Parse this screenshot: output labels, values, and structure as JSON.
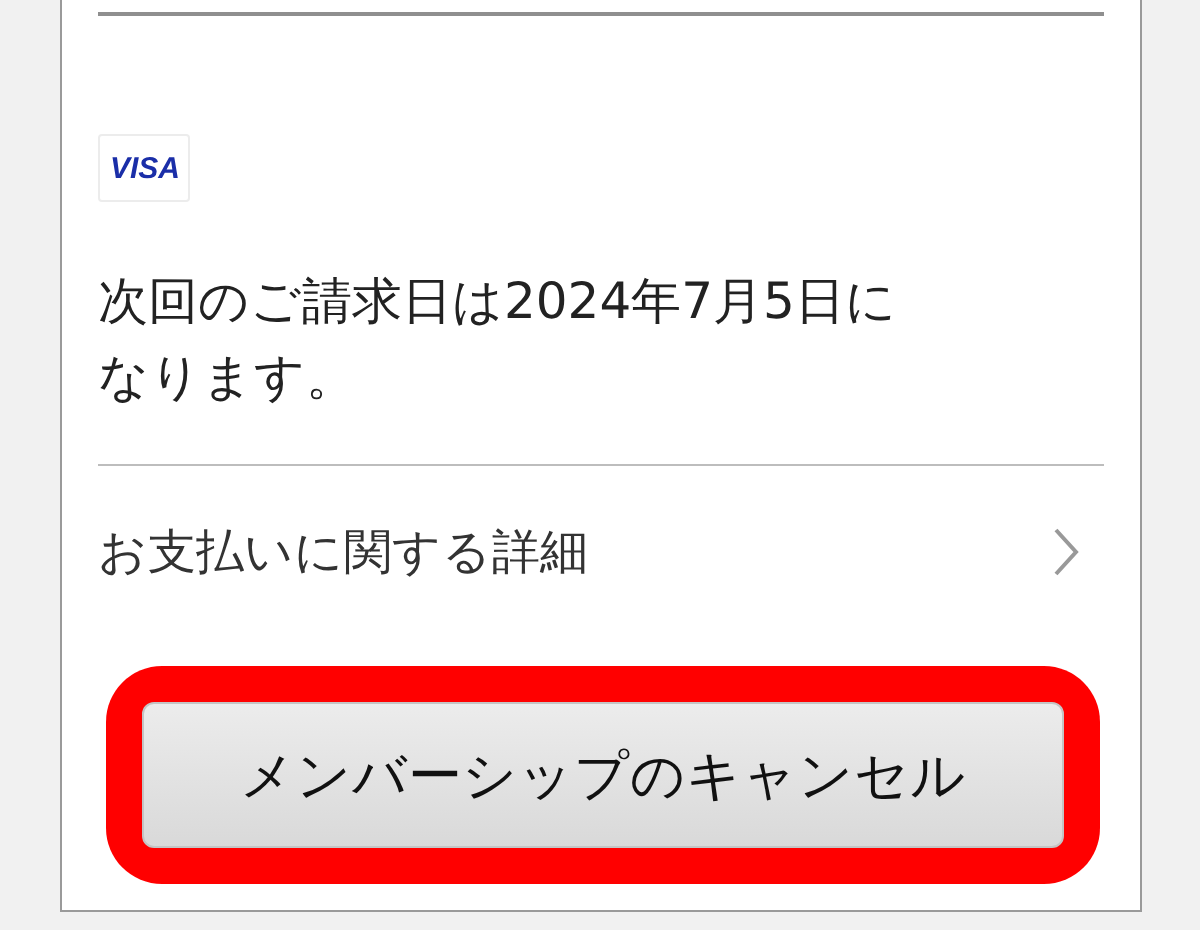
{
  "payment_method": {
    "brand": "VISA"
  },
  "billing_notice": "次回のご請求日は2024年7月5日になります。",
  "payment_details_link": {
    "label": "お支払いに関する詳細"
  },
  "cancel_button": {
    "label": "メンバーシップのキャンセル",
    "highlighted": true
  }
}
